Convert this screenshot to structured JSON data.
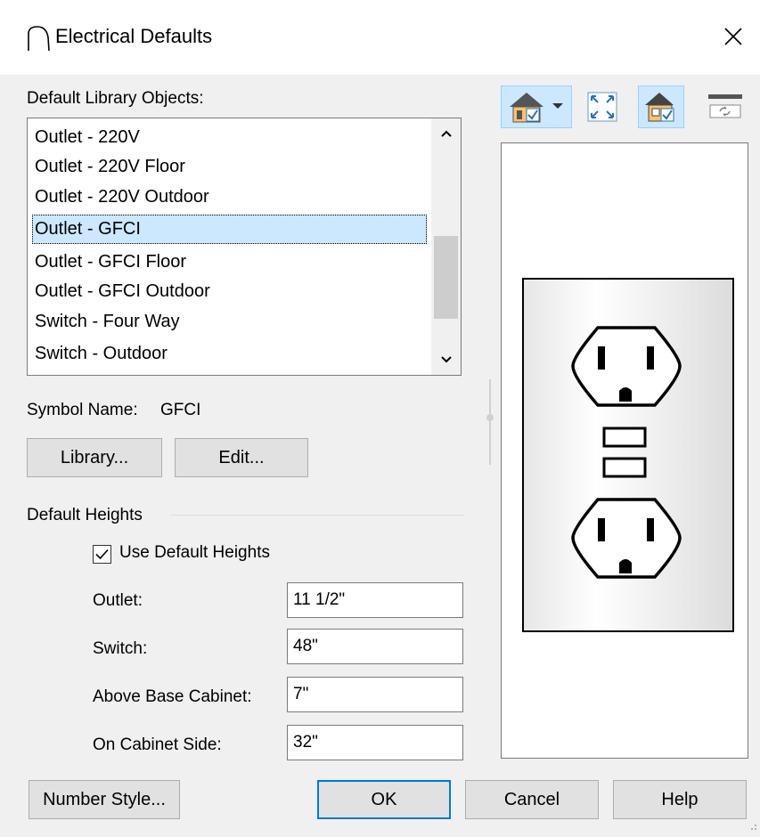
{
  "window": {
    "title": "Electrical Defaults",
    "icon": "chief-architect-arc-icon"
  },
  "library": {
    "label": "Default Library Objects:",
    "items": [
      "Outlet - 220V",
      "Outlet - 220V Floor",
      "Outlet - 220V Outdoor",
      "Outlet - GFCI",
      "Outlet - GFCI Floor",
      "Outlet - GFCI Outdoor",
      "Switch - Four Way",
      "Switch - Outdoor"
    ],
    "selected_index": 3
  },
  "symbol": {
    "label": "Symbol Name:",
    "value": "GFCI"
  },
  "buttons": {
    "library": "Library...",
    "edit": "Edit...",
    "number_style": "Number Style...",
    "ok": "OK",
    "cancel": "Cancel",
    "help": "Help"
  },
  "heights": {
    "group_label": "Default Heights",
    "use_defaults_label": "Use Default Heights",
    "use_defaults_checked": true,
    "fields": [
      {
        "label": "Outlet:",
        "value": "11 1/2\""
      },
      {
        "label": "Switch:",
        "value": "48\""
      },
      {
        "label": "Above Base Cabinet:",
        "value": "7\""
      },
      {
        "label": "On Cabinet Side:",
        "value": "32\""
      }
    ]
  },
  "preview": {
    "toolbar": [
      "view-options-icon",
      "fit-to-window-icon",
      "3d-view-icon",
      "refresh-icon"
    ],
    "subject": "gfci-duplex-outlet"
  },
  "colors": {
    "selection": "#cce8ff",
    "default_button_border": "#0078d7",
    "toolbar_active": "#cce8ff"
  }
}
